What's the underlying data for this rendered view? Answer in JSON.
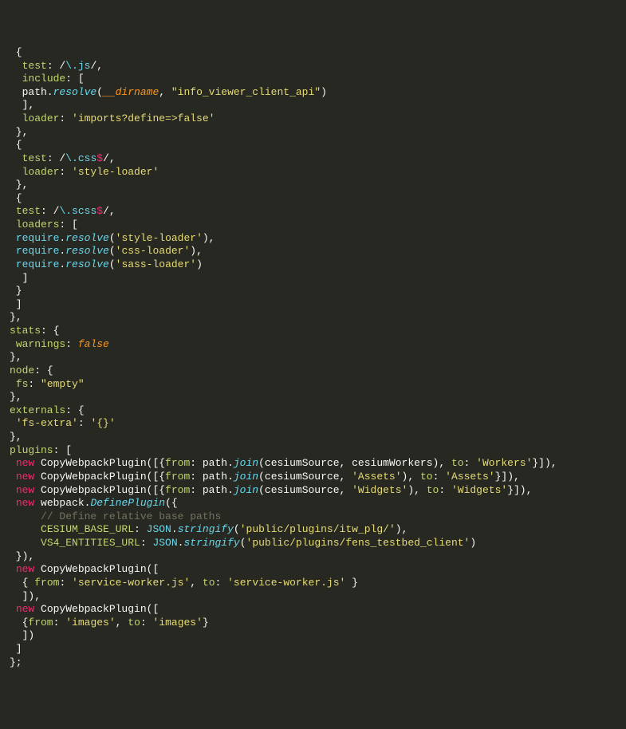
{
  "code": {
    "lines": [
      [
        [
          "p",
          " {"
        ]
      ],
      [
        [
          "p",
          "  "
        ],
        [
          "k",
          "test"
        ],
        [
          "p",
          ": /"
        ],
        [
          "re",
          "\\.js"
        ],
        [
          "p",
          "/,"
        ]
      ],
      [
        [
          "p",
          "  "
        ],
        [
          "k",
          "include"
        ],
        [
          "p",
          ": ["
        ]
      ],
      [
        [
          "p",
          "  path."
        ],
        [
          "fn",
          "resolve"
        ],
        [
          "p",
          "("
        ],
        [
          "co",
          "__dirname"
        ],
        [
          "p",
          ", "
        ],
        [
          "s",
          "\"info_viewer_client_api\""
        ],
        [
          "p",
          ")"
        ]
      ],
      [
        [
          "p",
          "  ],"
        ]
      ],
      [
        [
          "p",
          "  "
        ],
        [
          "k",
          "loader"
        ],
        [
          "p",
          ": "
        ],
        [
          "s",
          "'imports?define=>false'"
        ]
      ],
      [
        [
          "p",
          " },"
        ]
      ],
      [
        [
          "p",
          " {"
        ]
      ],
      [
        [
          "p",
          "  "
        ],
        [
          "k",
          "test"
        ],
        [
          "p",
          ": /"
        ],
        [
          "re",
          "\\.css"
        ],
        [
          "rd",
          "$"
        ],
        [
          "p",
          "/,"
        ]
      ],
      [
        [
          "p",
          "  "
        ],
        [
          "k",
          "loader"
        ],
        [
          "p",
          ": "
        ],
        [
          "s",
          "'style-loader'"
        ]
      ],
      [
        [
          "p",
          " },"
        ]
      ],
      [
        [
          "p",
          " {"
        ]
      ],
      [
        [
          "p",
          " "
        ],
        [
          "k",
          "test"
        ],
        [
          "p",
          ": /"
        ],
        [
          "re",
          "\\.scss"
        ],
        [
          "rd",
          "$"
        ],
        [
          "p",
          "/,"
        ]
      ],
      [
        [
          "p",
          " "
        ],
        [
          "k",
          "loaders"
        ],
        [
          "p",
          ": ["
        ]
      ],
      [
        [
          "p",
          " "
        ],
        [
          "j",
          "require"
        ],
        [
          "p",
          "."
        ],
        [
          "fn",
          "resolve"
        ],
        [
          "p",
          "("
        ],
        [
          "s",
          "'style-loader'"
        ],
        [
          "p",
          "),"
        ]
      ],
      [
        [
          "p",
          " "
        ],
        [
          "j",
          "require"
        ],
        [
          "p",
          "."
        ],
        [
          "fn",
          "resolve"
        ],
        [
          "p",
          "("
        ],
        [
          "s",
          "'css-loader'"
        ],
        [
          "p",
          "),"
        ]
      ],
      [
        [
          "p",
          " "
        ],
        [
          "j",
          "require"
        ],
        [
          "p",
          "."
        ],
        [
          "fn",
          "resolve"
        ],
        [
          "p",
          "("
        ],
        [
          "s",
          "'sass-loader'"
        ],
        [
          "p",
          ")"
        ]
      ],
      [
        [
          "p",
          "  ]"
        ]
      ],
      [
        [
          "p",
          " }"
        ]
      ],
      [
        [
          "p",
          " ]"
        ]
      ],
      [
        [
          "p",
          "},"
        ]
      ],
      [
        [
          "k",
          "stats"
        ],
        [
          "p",
          ": {"
        ]
      ],
      [
        [
          "p",
          " "
        ],
        [
          "k",
          "warnings"
        ],
        [
          "p",
          ": "
        ],
        [
          "co",
          "false"
        ]
      ],
      [
        [
          "p",
          "},"
        ]
      ],
      [
        [
          "k",
          "node"
        ],
        [
          "p",
          ": {"
        ]
      ],
      [
        [
          "p",
          " "
        ],
        [
          "k",
          "fs"
        ],
        [
          "p",
          ": "
        ],
        [
          "s",
          "\"empty\""
        ]
      ],
      [
        [
          "p",
          "},"
        ]
      ],
      [
        [
          "k",
          "externals"
        ],
        [
          "p",
          ": {"
        ]
      ],
      [
        [
          "p",
          " "
        ],
        [
          "s",
          "'fs-extra'"
        ],
        [
          "p",
          ": "
        ],
        [
          "s",
          "'{}'"
        ]
      ],
      [
        [
          "p",
          "},"
        ]
      ],
      [
        [
          "k",
          "plugins"
        ],
        [
          "p",
          ": ["
        ]
      ],
      [
        [
          "p",
          " "
        ],
        [
          "nw",
          "new"
        ],
        [
          "p",
          " CopyWebpackPlugin([{"
        ],
        [
          "k",
          "from"
        ],
        [
          "p",
          ": path."
        ],
        [
          "fn",
          "join"
        ],
        [
          "p",
          "(cesiumSource, cesiumWorkers), "
        ],
        [
          "k",
          "to"
        ],
        [
          "p",
          ": "
        ],
        [
          "s",
          "'Workers'"
        ],
        [
          "p",
          "}]),"
        ]
      ],
      [
        [
          "p",
          " "
        ],
        [
          "nw",
          "new"
        ],
        [
          "p",
          " CopyWebpackPlugin([{"
        ],
        [
          "k",
          "from"
        ],
        [
          "p",
          ": path."
        ],
        [
          "fn",
          "join"
        ],
        [
          "p",
          "(cesiumSource, "
        ],
        [
          "s",
          "'Assets'"
        ],
        [
          "p",
          "), "
        ],
        [
          "k",
          "to"
        ],
        [
          "p",
          ": "
        ],
        [
          "s",
          "'Assets'"
        ],
        [
          "p",
          "}]),"
        ]
      ],
      [
        [
          "p",
          " "
        ],
        [
          "nw",
          "new"
        ],
        [
          "p",
          " CopyWebpackPlugin([{"
        ],
        [
          "k",
          "from"
        ],
        [
          "p",
          ": path."
        ],
        [
          "fn",
          "join"
        ],
        [
          "p",
          "(cesiumSource, "
        ],
        [
          "s",
          "'Widgets'"
        ],
        [
          "p",
          "), "
        ],
        [
          "k",
          "to"
        ],
        [
          "p",
          ": "
        ],
        [
          "s",
          "'Widgets'"
        ],
        [
          "p",
          "}]),"
        ]
      ],
      [
        [
          "p",
          " "
        ],
        [
          "nw",
          "new"
        ],
        [
          "p",
          " webpack."
        ],
        [
          "fn",
          "DefinePlugin"
        ],
        [
          "p",
          "({"
        ]
      ],
      [
        [
          "p",
          "     "
        ],
        [
          "cm",
          "// Define relative base paths"
        ]
      ],
      [
        [
          "p",
          "     "
        ],
        [
          "k",
          "CESIUM_BASE_URL"
        ],
        [
          "p",
          ": "
        ],
        [
          "j",
          "JSON"
        ],
        [
          "p",
          "."
        ],
        [
          "fn",
          "stringify"
        ],
        [
          "p",
          "("
        ],
        [
          "s",
          "'public/plugins/itw_plg/'"
        ],
        [
          "p",
          "),"
        ]
      ],
      [
        [
          "p",
          "     "
        ],
        [
          "k",
          "VS4_ENTITIES_URL"
        ],
        [
          "p",
          ": "
        ],
        [
          "j",
          "JSON"
        ],
        [
          "p",
          "."
        ],
        [
          "fn",
          "stringify"
        ],
        [
          "p",
          "("
        ],
        [
          "s",
          "'public/plugins/fens_testbed_client'"
        ],
        [
          "p",
          ")"
        ]
      ],
      [
        [
          "p",
          " }),"
        ]
      ],
      [
        [
          "p",
          " "
        ],
        [
          "nw",
          "new"
        ],
        [
          "p",
          " CopyWebpackPlugin(["
        ]
      ],
      [
        [
          "p",
          "  { "
        ],
        [
          "k",
          "from"
        ],
        [
          "p",
          ": "
        ],
        [
          "s",
          "'service-worker.js'"
        ],
        [
          "p",
          ", "
        ],
        [
          "k",
          "to"
        ],
        [
          "p",
          ": "
        ],
        [
          "s",
          "'service-worker.js'"
        ],
        [
          "p",
          " }"
        ]
      ],
      [
        [
          "p",
          "  ]),"
        ]
      ],
      [
        [
          "p",
          " "
        ],
        [
          "nw",
          "new"
        ],
        [
          "p",
          " CopyWebpackPlugin(["
        ]
      ],
      [
        [
          "p",
          "  {"
        ],
        [
          "k",
          "from"
        ],
        [
          "p",
          ": "
        ],
        [
          "s",
          "'images'"
        ],
        [
          "p",
          ", "
        ],
        [
          "k",
          "to"
        ],
        [
          "p",
          ": "
        ],
        [
          "s",
          "'images'"
        ],
        [
          "p",
          "}"
        ]
      ],
      [
        [
          "p",
          "  ])"
        ]
      ],
      [
        [
          "p",
          " ]"
        ]
      ],
      [
        [
          "p",
          "};"
        ]
      ]
    ]
  },
  "token_classes": {
    "p": "punct",
    "k": "tok-keyword",
    "nw": "tok-new",
    "re": "tok-regex-esc",
    "rd": "tok-regex-dol",
    "s": "tok-string",
    "fn": "tok-func",
    "co": "tok-const",
    "cm": "tok-comment",
    "j": "tok-json"
  }
}
